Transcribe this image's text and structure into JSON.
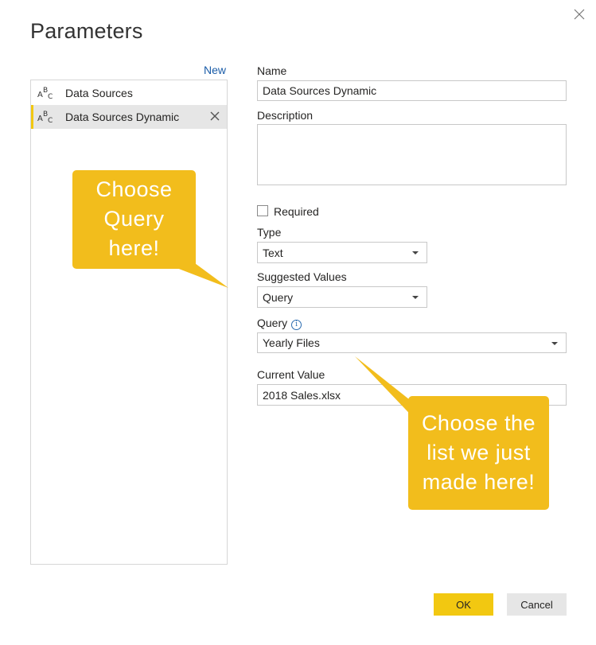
{
  "dialog": {
    "title": "Parameters",
    "new_label": "New"
  },
  "sidebar": {
    "items": [
      {
        "label": "Data Sources",
        "icon": "abc-text-type-icon"
      },
      {
        "label": "Data Sources Dynamic",
        "icon": "abc-text-type-icon",
        "selected": true
      }
    ]
  },
  "form": {
    "name_label": "Name",
    "name_value": "Data Sources Dynamic",
    "description_label": "Description",
    "description_value": "",
    "required_label": "Required",
    "required_checked": false,
    "type_label": "Type",
    "type_value": "Text",
    "suggested_label": "Suggested Values",
    "suggested_value": "Query",
    "query_label": "Query",
    "query_value": "Yearly Files",
    "current_label": "Current Value",
    "current_value": "2018 Sales.xlsx"
  },
  "callouts": {
    "left": [
      "Choose",
      "Query",
      "here!"
    ],
    "right": [
      "Choose the",
      "list we just",
      "made here!"
    ],
    "color": "#f2bd1c"
  },
  "buttons": {
    "ok": "OK",
    "cancel": "Cancel"
  },
  "colors": {
    "accent": "#f2c811",
    "link": "#1a5ca8"
  }
}
